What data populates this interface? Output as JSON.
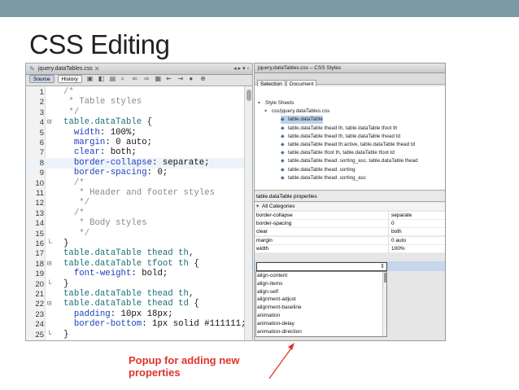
{
  "slide": {
    "title": "CSS Editing",
    "caption": "Popup for adding new properties",
    "topbar_color": "#7d9aa4",
    "caption_color": "#e0332b"
  },
  "editor": {
    "tab_title": "jquery.dataTables.css",
    "toolbar": {
      "source_label": "Source",
      "history_label": "History"
    },
    "lines": [
      {
        "n": "1",
        "fold": "",
        "parts": [
          {
            "t": "/*",
            "c": "com"
          }
        ]
      },
      {
        "n": "2",
        "fold": "",
        "parts": [
          {
            "t": " * Table styles",
            "c": "com"
          }
        ]
      },
      {
        "n": "3",
        "fold": "",
        "parts": [
          {
            "t": " */",
            "c": "com"
          }
        ]
      },
      {
        "n": "4",
        "fold": "⊟",
        "parts": [
          {
            "t": "table.dataTable",
            "c": "sel"
          },
          {
            "t": " {",
            "c": "pun"
          }
        ]
      },
      {
        "n": "5",
        "fold": "",
        "parts": [
          {
            "t": "  width",
            "c": "prop"
          },
          {
            "t": ": 100%;",
            "c": "val"
          }
        ]
      },
      {
        "n": "6",
        "fold": "",
        "parts": [
          {
            "t": "  margin",
            "c": "prop"
          },
          {
            "t": ": 0 auto;",
            "c": "val"
          }
        ]
      },
      {
        "n": "7",
        "fold": "",
        "parts": [
          {
            "t": "  clear",
            "c": "prop"
          },
          {
            "t": ": both;",
            "c": "val"
          }
        ]
      },
      {
        "n": "8",
        "fold": "",
        "hl": true,
        "parts": [
          {
            "t": "  border-collapse",
            "c": "prop"
          },
          {
            "t": ": separate;",
            "c": "val"
          }
        ]
      },
      {
        "n": "9",
        "fold": "",
        "parts": [
          {
            "t": "  border-spacing",
            "c": "prop"
          },
          {
            "t": ": 0;",
            "c": "val"
          }
        ]
      },
      {
        "n": "10",
        "fold": "",
        "parts": [
          {
            "t": "  /*",
            "c": "com"
          }
        ]
      },
      {
        "n": "11",
        "fold": "",
        "parts": [
          {
            "t": "   * Header and footer styles",
            "c": "com"
          }
        ]
      },
      {
        "n": "12",
        "fold": "",
        "parts": [
          {
            "t": "   */",
            "c": "com"
          }
        ]
      },
      {
        "n": "13",
        "fold": "",
        "parts": [
          {
            "t": "  /*",
            "c": "com"
          }
        ]
      },
      {
        "n": "14",
        "fold": "",
        "parts": [
          {
            "t": "   * Body styles",
            "c": "com"
          }
        ]
      },
      {
        "n": "15",
        "fold": "",
        "parts": [
          {
            "t": "   */",
            "c": "com"
          }
        ]
      },
      {
        "n": "16",
        "fold": "└",
        "parts": [
          {
            "t": "}",
            "c": "pun"
          }
        ]
      },
      {
        "n": "17",
        "fold": "",
        "parts": [
          {
            "t": "table.dataTable thead th",
            "c": "sel"
          },
          {
            "t": ",",
            "c": "pun"
          }
        ]
      },
      {
        "n": "18",
        "fold": "⊟",
        "parts": [
          {
            "t": "table.dataTable tfoot th",
            "c": "sel"
          },
          {
            "t": " {",
            "c": "pun"
          }
        ]
      },
      {
        "n": "19",
        "fold": "",
        "parts": [
          {
            "t": "  font-weight",
            "c": "prop"
          },
          {
            "t": ": bold;",
            "c": "val"
          }
        ]
      },
      {
        "n": "20",
        "fold": "└",
        "parts": [
          {
            "t": "}",
            "c": "pun"
          }
        ]
      },
      {
        "n": "21",
        "fold": "",
        "parts": [
          {
            "t": "table.dataTable thead th",
            "c": "sel"
          },
          {
            "t": ",",
            "c": "pun"
          }
        ]
      },
      {
        "n": "22",
        "fold": "⊟",
        "parts": [
          {
            "t": "table.dataTable thead td",
            "c": "sel"
          },
          {
            "t": " {",
            "c": "pun"
          }
        ]
      },
      {
        "n": "23",
        "fold": "",
        "parts": [
          {
            "t": "  padding",
            "c": "prop"
          },
          {
            "t": ": 10px 18px;",
            "c": "val"
          }
        ]
      },
      {
        "n": "24",
        "fold": "",
        "parts": [
          {
            "t": "  border-bottom",
            "c": "prop"
          },
          {
            "t": ": 1px solid #111111;",
            "c": "val"
          }
        ]
      },
      {
        "n": "25",
        "fold": "└",
        "parts": [
          {
            "t": "}",
            "c": "pun"
          }
        ]
      }
    ]
  },
  "styles_panel": {
    "title": "jquery.dataTables.css – CSS Styles",
    "tabs": [
      {
        "label": "Selection",
        "active": false
      },
      {
        "label": "Document",
        "active": true
      }
    ],
    "tree": [
      {
        "label": "Style Sheets",
        "level": 0,
        "sel": false
      },
      {
        "label": "css/jquery.dataTables.css",
        "level": 1,
        "sel": false
      },
      {
        "label": "table.dataTable",
        "level": 2,
        "sel": true
      },
      {
        "label": "table.dataTable thead th, table.dataTable tfoot th",
        "level": 2,
        "sel": false
      },
      {
        "label": "table.dataTable thead th, table.dataTable thead td",
        "level": 2,
        "sel": false
      },
      {
        "label": "table.dataTable thead th:active, table.dataTable thead td",
        "level": 2,
        "sel": false
      },
      {
        "label": "table.dataTable tfoot th, table.dataTable tfoot td",
        "level": 2,
        "sel": false
      },
      {
        "label": "table.dataTable thead .sorting_asc, table.dataTable thead",
        "level": 2,
        "sel": false
      },
      {
        "label": "table.dataTable thead .sorting",
        "level": 2,
        "sel": false
      },
      {
        "label": "table.dataTable thead .sorting_asc",
        "level": 2,
        "sel": false
      }
    ],
    "properties_header": "table.dataTable properties",
    "category": "All Categories",
    "properties": [
      {
        "k": "border-collapse",
        "v": "separate"
      },
      {
        "k": "border-spacing",
        "v": "0"
      },
      {
        "k": "clear",
        "v": "both"
      },
      {
        "k": "margin",
        "v": "0 auto"
      },
      {
        "k": "width",
        "v": "100%"
      }
    ],
    "popup_items": [
      "align-content",
      "align-items",
      "align-self",
      "alignment-adjust",
      "alignment-baseline",
      "animation",
      "animation-delay",
      "animation-direction"
    ]
  }
}
